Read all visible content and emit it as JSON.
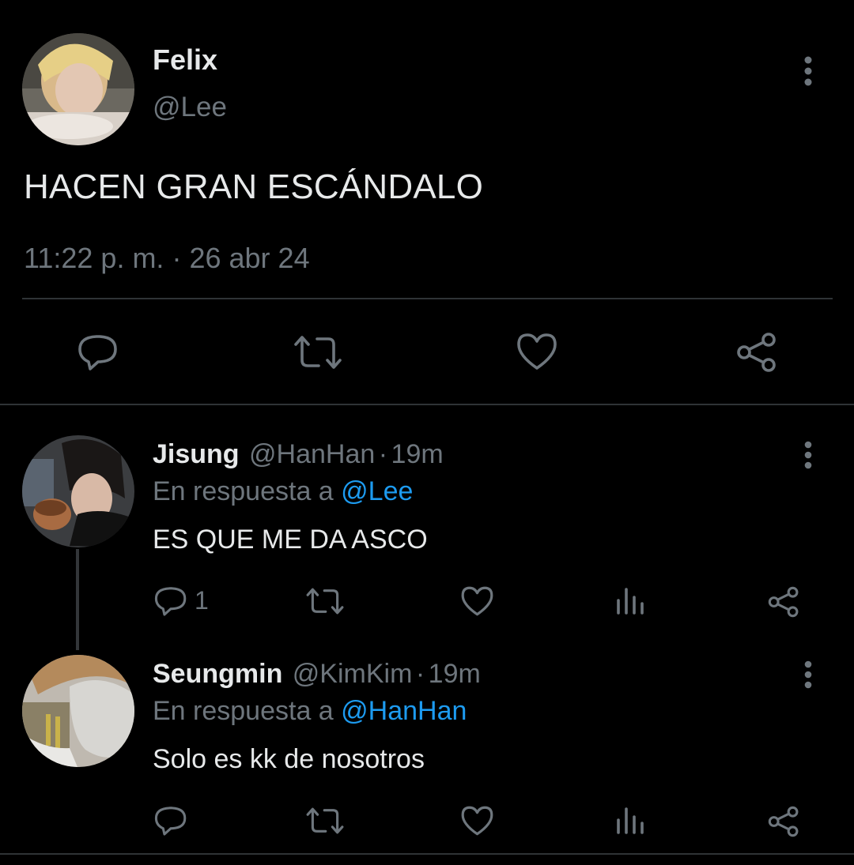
{
  "tweet": {
    "author_name": "Felix",
    "handle": "@Lee",
    "text": "HACEN GRAN ESCÁNDALO",
    "time": "11:22 p. m.",
    "separator": "·",
    "date": "26 abr 24",
    "actions": [
      "reply-icon",
      "retweet-icon",
      "like-icon",
      "share-icon"
    ]
  },
  "replies": [
    {
      "author_name": "Jisung",
      "handle": "@HanHan",
      "separator": "·",
      "age": "19m",
      "reply_prefix": "En respuesta a",
      "reply_to": "@Lee",
      "text": "ES QUE ME DA ASCO",
      "reply_count": "1"
    },
    {
      "author_name": "Seungmin",
      "handle": "@KimKim",
      "separator": "·",
      "age": "19m",
      "reply_prefix": "En respuesta a",
      "reply_to": "@HanHan",
      "text": "Solo es kk de nosotros",
      "reply_count": ""
    }
  ],
  "colors": {
    "background": "#000000",
    "text": "#e7e9ea",
    "secondary": "#6e767d",
    "link": "#1d9bf0",
    "divider": "#2f3336"
  }
}
